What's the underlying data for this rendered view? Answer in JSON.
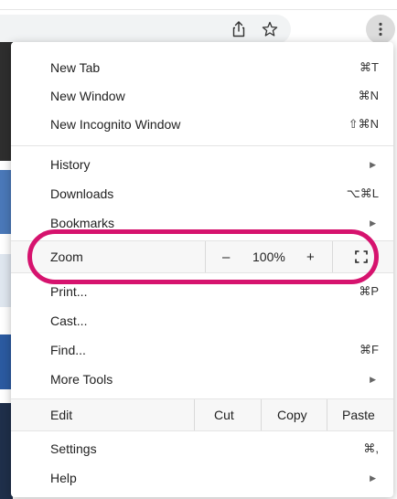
{
  "toolbar": {
    "share_icon": "share-icon",
    "star_icon": "bookmark-star-icon",
    "menu_icon": "kebab-menu-icon"
  },
  "menu": {
    "new_tab": {
      "label": "New Tab",
      "shortcut": "⌘T"
    },
    "new_window": {
      "label": "New Window",
      "shortcut": "⌘N"
    },
    "new_incognito": {
      "label": "New Incognito Window",
      "shortcut": "⇧⌘N"
    },
    "history": {
      "label": "History"
    },
    "downloads": {
      "label": "Downloads",
      "shortcut": "⌥⌘L"
    },
    "bookmarks": {
      "label": "Bookmarks"
    },
    "zoom": {
      "label": "Zoom",
      "minus": "–",
      "value": "100%",
      "plus": "+"
    },
    "print": {
      "label": "Print...",
      "shortcut": "⌘P"
    },
    "cast": {
      "label": "Cast..."
    },
    "find": {
      "label": "Find...",
      "shortcut": "⌘F"
    },
    "more_tools": {
      "label": "More Tools"
    },
    "edit": {
      "label": "Edit",
      "cut": "Cut",
      "copy": "Copy",
      "paste": "Paste"
    },
    "settings": {
      "label": "Settings",
      "shortcut": "⌘,"
    },
    "help": {
      "label": "Help"
    }
  },
  "colors": {
    "highlight": "#d6136e",
    "menu_bg": "#ffffff",
    "row_band": "#f7f7f7"
  }
}
